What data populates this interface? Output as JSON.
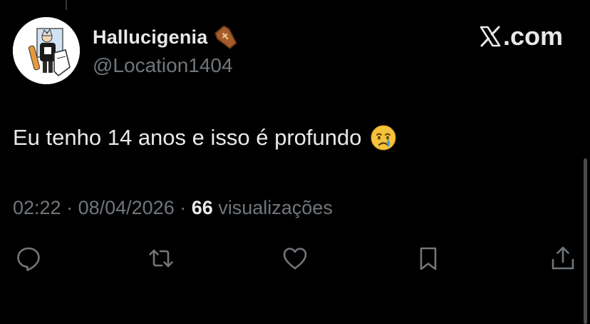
{
  "tweet": {
    "author": {
      "display_name": "Hallucigenia",
      "name_emoji": "coffin-icon",
      "handle": "@Location1404",
      "avatar": "avatar-illustration"
    },
    "brand": {
      "icon": "x-logo-icon",
      "suffix": ".com"
    },
    "text": "Eu tenho 14 anos e isso é profundo",
    "text_emoji": "crying-face-icon",
    "meta": {
      "time": "02:22",
      "date": "08/04/2026",
      "separator": " · ",
      "views_count": "66",
      "views_label": " visualizações"
    },
    "actions": [
      {
        "name": "reply",
        "icon": "reply-icon"
      },
      {
        "name": "retweet",
        "icon": "retweet-icon"
      },
      {
        "name": "like",
        "icon": "heart-icon"
      },
      {
        "name": "bookmark",
        "icon": "bookmark-icon"
      },
      {
        "name": "share",
        "icon": "share-icon"
      }
    ]
  },
  "colors": {
    "background": "#000000",
    "primary_text": "#e7e9ea",
    "secondary_text": "#71767b"
  }
}
